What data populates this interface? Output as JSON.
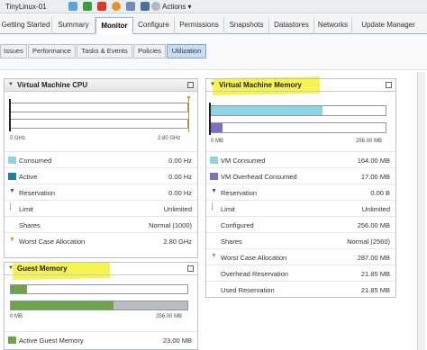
{
  "toolbar": {
    "vm_name": "TinyLinux-01",
    "actions_label": "Actions",
    "actions_caret": "▾"
  },
  "tabs": [
    {
      "label": "Getting Started"
    },
    {
      "label": "Summary"
    },
    {
      "label": "Monitor"
    },
    {
      "label": "Configure"
    },
    {
      "label": "Permissions"
    },
    {
      "label": "Snapshots"
    },
    {
      "label": "Datastores"
    },
    {
      "label": "Networks"
    },
    {
      "label": "Update Manager"
    }
  ],
  "subtabs": [
    {
      "label": "Issues"
    },
    {
      "label": "Performance"
    },
    {
      "label": "Tasks & Events"
    },
    {
      "label": "Policies"
    },
    {
      "label": "Utilization"
    }
  ],
  "colors": {
    "consumed": "#8ed3e6",
    "active": "#1f7ea6",
    "vm_overhead": "#7b70c4",
    "guest_used": "#6ea34a",
    "highlight": "#f5f232",
    "marker": "#e08a1e"
  },
  "cpu": {
    "title": "Virtual Machine CPU",
    "axis_min": "0 GHz",
    "axis_max": "2.80 GHz",
    "consumed_fraction": 0.0,
    "worst_case_fraction": 1.0,
    "rows": [
      {
        "label": "Consumed",
        "value": "0.00 Hz",
        "marker": "swatch-consumed"
      },
      {
        "label": "Active",
        "value": "0.00 Hz",
        "marker": "swatch-active"
      },
      {
        "label": "Reservation",
        "value": "0.00 Hz",
        "marker": "arrow-icon"
      },
      {
        "label": "Limit",
        "value": "Unlimited",
        "marker": "bar-icon"
      },
      {
        "label": "Shares",
        "value": "Normal (1000)",
        "marker": "none"
      },
      {
        "label": "Worst Case Allocation",
        "value": "2.80 GHz",
        "marker": "orange-arrow-icon"
      }
    ]
  },
  "vm_memory": {
    "title": "Virtual Machine Memory",
    "axis_min": "0 MB",
    "axis_max": "256.00 MB",
    "consumed_fraction": 0.64,
    "overhead_fraction": 0.066,
    "rows": [
      {
        "label": "VM Consumed",
        "value": "164.00 MB",
        "marker": "swatch-consumed"
      },
      {
        "label": "VM Overhead Consumed",
        "value": "17.00 MB",
        "marker": "swatch-overhead"
      },
      {
        "label": "Reservation",
        "value": "0.00 B",
        "marker": "arrow-icon"
      },
      {
        "label": "Limit",
        "value": "Unlimited",
        "marker": "bar-icon"
      },
      {
        "label": "Configured",
        "value": "256.00 MB",
        "marker": "none"
      },
      {
        "label": "Shares",
        "value": "Normal (2560)",
        "marker": "none"
      },
      {
        "label": "Worst Case Allocation",
        "value": "287.00 MB",
        "marker": "orange-arrow-icon"
      },
      {
        "label": "Overhead Reservation",
        "value": "21.85 MB",
        "marker": "none"
      },
      {
        "label": "Used Reservation",
        "value": "21.85 MB",
        "marker": "none"
      }
    ]
  },
  "guest_memory": {
    "title": "Guest Memory",
    "axis_min": "0 MB",
    "axis_max": "256.00 MB",
    "active_fraction": 0.09,
    "used_fraction": 0.58,
    "rows": [
      {
        "label": "Active Guest Memory",
        "value": "23.00 MB",
        "marker": "swatch-guest"
      }
    ]
  }
}
